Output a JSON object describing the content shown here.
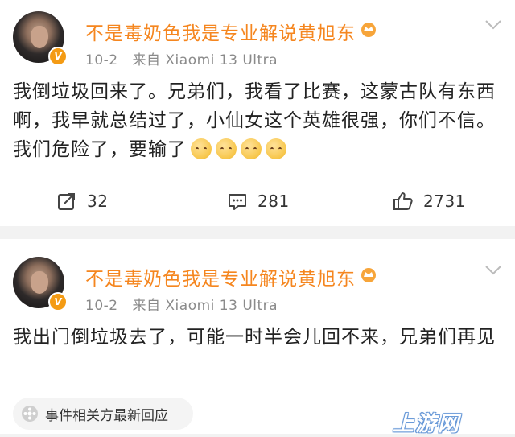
{
  "posts": [
    {
      "author": "不是毒奶色我是专业解说黄旭东",
      "date": "10-2",
      "source": "来自 Xiaomi 13 Ultra",
      "verified_badge": "V",
      "text": "我倒垃圾回来了。兄弟们，我看了比赛，这蒙古队有东西啊，我早就总结过了，小仙女这个英雄很强，你们不信。我们危险了，要输了",
      "emoji_count": 4,
      "emoji_icon": "pensive-face-emoji",
      "actions": {
        "repost": "32",
        "comment": "281",
        "like": "2731"
      }
    },
    {
      "author": "不是毒奶色我是专业解说黄旭东",
      "date": "10-2",
      "source": "来自 Xiaomi 13 Ultra",
      "verified_badge": "V",
      "text": "我出门倒垃圾去了，可能一时半会儿回不来，兄弟们再见",
      "related_label": "事件相关方最新回应"
    }
  ],
  "colors": {
    "author": "#f5861f",
    "verified": "#f49b14",
    "meta": "#8a8a8a",
    "background": "#f2f2f2"
  },
  "watermark": "上游网"
}
